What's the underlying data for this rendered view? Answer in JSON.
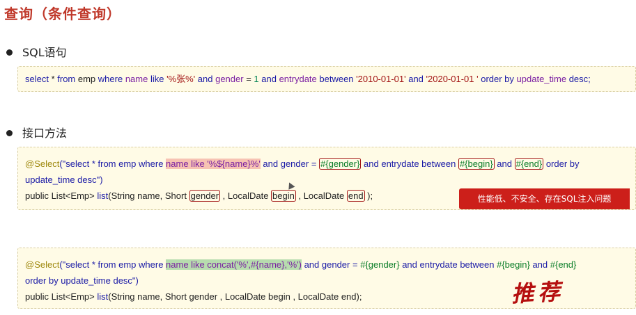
{
  "page": {
    "title": "查询（条件查询）"
  },
  "sections": {
    "sql_heading": "SQL语句",
    "iface_heading": "接口方法"
  },
  "sql": {
    "select": "select",
    "star": " * ",
    "from": "from",
    "emp1": " emp ",
    "where": "where",
    "name": " name ",
    "like": "like",
    "pat": " '%张%' ",
    "and1": "and",
    "gender": " gender ",
    "eq": "= ",
    "one": "1",
    "and2": " and ",
    "entrydate": "entrydate",
    "between": " between ",
    "d1": "'2010-01-01'",
    "and3": " and ",
    "d2": "'2020-01-01 '",
    "order": " order by ",
    "ut": "update_time",
    "desc": " desc;"
  },
  "block1": {
    "ann": "@Select",
    "p1": "(\"select * from emp where ",
    "hl": "name like '%${name}%'",
    "p2": " and gender = ",
    "v_gender": "#{gender}",
    "p3": " and entrydate between ",
    "v_begin": "#{begin}",
    "p4": " and ",
    "v_end": "#{end}",
    "p5": " order by",
    "line2": "update_time desc\")",
    "l3a": "public List<Emp> ",
    "l3b": "list",
    "l3c": "(String name, Short ",
    "l3g": "gender",
    "l3d": " , LocalDate ",
    "l3bg": "begin",
    "l3e": " , LocalDate ",
    "l3en": "end",
    "l3f": " );"
  },
  "badge": "性能低、不安全、存在SQL注入问题",
  "block2": {
    "ann": "@Select",
    "p1": "(\"select * from emp where ",
    "hl": "name like  concat('%',#{name},'%')",
    "p2": " and gender = ",
    "v_gender": "#{gender}",
    "p3": " and entrydate between ",
    "v_begin": "#{begin}",
    "p4": " and ",
    "v_end": "#{end}",
    "line2": "order by update_time desc\")",
    "l3a": "public List<Emp> ",
    "l3b": "list",
    "l3c": "(String name, Short gender , LocalDate begin , LocalDate end);"
  },
  "recommend": "推荐",
  "colors": {
    "title": "#c0392b",
    "badge": "#cc1f1a",
    "recommend": "#b50f0f"
  }
}
